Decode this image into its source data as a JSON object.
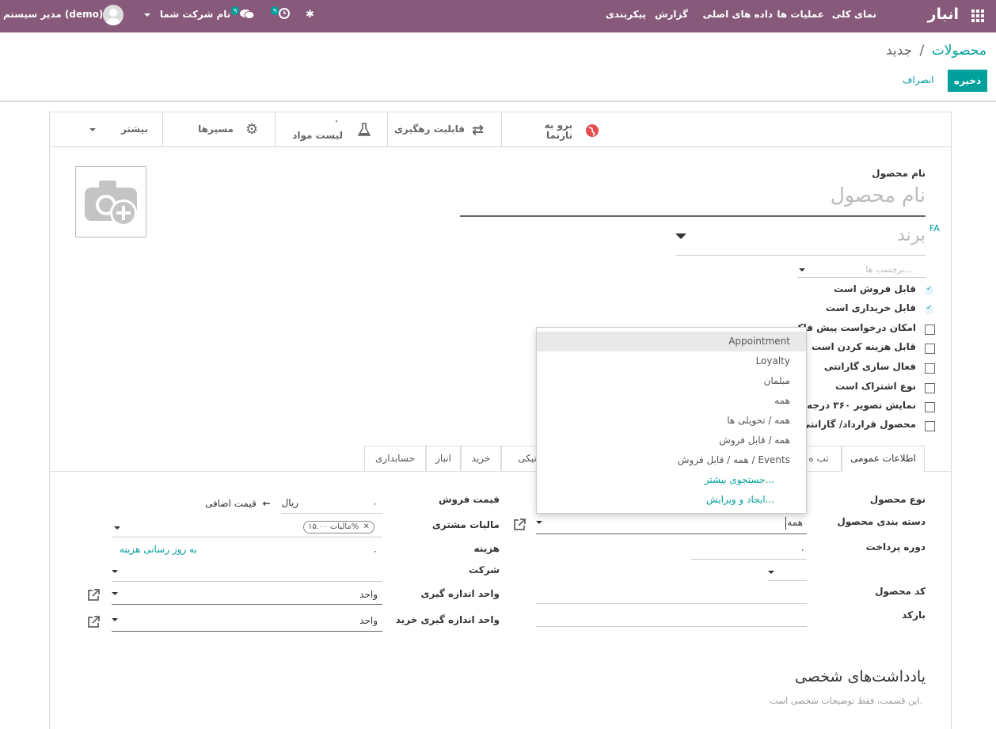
{
  "navbar": {
    "app_name": "انبار",
    "menu": [
      "نمای کلی",
      "عملیات ها",
      "داده های اصلی",
      "گزارش",
      "پیکربندی"
    ],
    "user": "مدیر سیستم (demo)",
    "company": "نام شرکت شما",
    "chat_badge": "۹",
    "activity_badge": "۹"
  },
  "breadcrumb": {
    "parent": "محصولات",
    "sep": "/",
    "current": "جدید"
  },
  "actions": {
    "save": "ذخیره",
    "discard": "انصراف"
  },
  "stat_buttons": {
    "website": "برو به\nتارنما",
    "traceability": "قابلیت رهگیری",
    "bom": "لیست مواد",
    "bom_count": "۰",
    "routes": "مسیرها",
    "more": "بیشتر"
  },
  "product": {
    "name_label": "نام محصول",
    "name_placeholder": "نام محصول",
    "brand_placeholder": "برند",
    "lang": "FA",
    "tags_placeholder": "برچسب ها..."
  },
  "checkboxes": [
    {
      "label": "قابل فروش است",
      "checked": true
    },
    {
      "label": "قابل خریداری است",
      "checked": true
    },
    {
      "label": "امکان درخواست پیش فاک",
      "checked": false
    },
    {
      "label": "قابل هزینه کردن است",
      "checked": false
    },
    {
      "label": "فعال سازی گارانتی",
      "checked": false
    },
    {
      "label": "نوع اشتراک است",
      "checked": false
    },
    {
      "label": "نمایش تصویر ۳۶۰ درجه",
      "checked": false
    },
    {
      "label": "محصول قرارداد/ گارانتی",
      "checked": false
    }
  ],
  "tabs": [
    "اطلاعات عمومی",
    "تب ه",
    "ونیکی",
    "خرید",
    "انبار",
    "حسابداری"
  ],
  "dropdown": {
    "items": [
      "Appointment",
      "Loyalty",
      "مبلمان",
      "همه",
      "همه / تحویلی ها",
      "همه / قابل فروش",
      "همه / قابل فروش / Events"
    ],
    "search_more": "جستجوی بیشتر...",
    "create_edit": "ایجاد و ویرایش..."
  },
  "general": {
    "product_type_label": "نوع محصول",
    "category_label": "دسته بندی محصول",
    "category_value": "همه",
    "payment_period_label": "دوره پرداخت",
    "payment_period_value": "۰",
    "code_label": "کد محصول",
    "barcode_label": "بارکد",
    "sale_price_label": "قیمت فروش",
    "sale_price_value": "۰",
    "currency": "ریال",
    "extra_price": "قیمت اضافی",
    "customer_tax_label": "مالیات مشتری",
    "tax_tag": "مالیات ۱۵.۰۰%",
    "cost_label": "هزینه",
    "cost_value": "۰",
    "update_cost": "به روز رسانی هزینه",
    "company_label": "شرکت",
    "uom_label": "واحد اندازه گیری",
    "uom_value": "واحد",
    "purchase_uom_label": "واحد اندازه گیری خرید",
    "purchase_uom_value": "واحد"
  },
  "notes": {
    "title": "یادداشت‌های شخصی",
    "placeholder": "این قسمت، فقط توضیحات شخصی است."
  }
}
